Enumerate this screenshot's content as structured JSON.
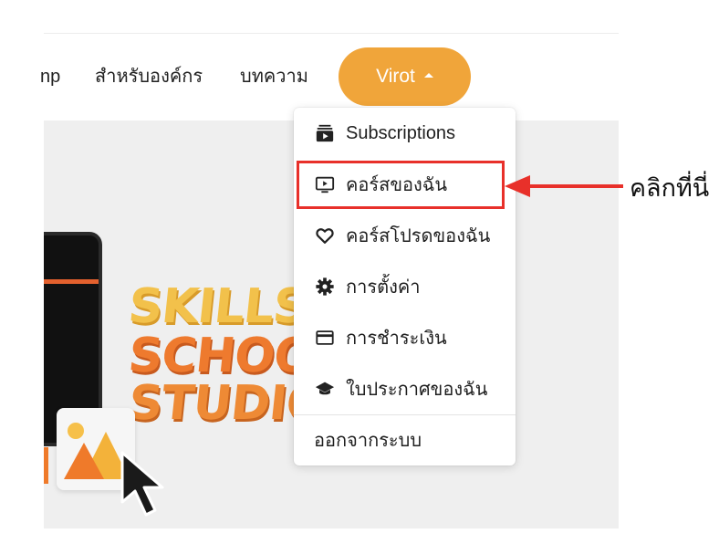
{
  "nav": {
    "partial_link": "np",
    "for_organization": "สำหรับองค์กร",
    "articles": "บทความ",
    "user_name": "Virot"
  },
  "banner": {
    "line1": "SKILLS",
    "line2": "SCHOOL",
    "line3": "STUDIO"
  },
  "menu": {
    "items": [
      {
        "label": "Subscriptions",
        "icon": "subscriptions-icon"
      },
      {
        "label": "คอร์สของฉัน",
        "icon": "play-screen-icon"
      },
      {
        "label": "คอร์สโปรดของฉัน",
        "icon": "heart-icon"
      },
      {
        "label": "การตั้งค่า",
        "icon": "gear-icon"
      },
      {
        "label": "การชำระเงิน",
        "icon": "credit-card-icon"
      },
      {
        "label": "ใบประกาศของฉัน",
        "icon": "graduation-cap-icon"
      }
    ],
    "logout": "ออกจากระบบ"
  },
  "annotation": {
    "label": "คลิกที่นี่",
    "color": "#e8302a"
  },
  "colors": {
    "accent": "#f0a53a",
    "highlight": "#e8302a"
  }
}
